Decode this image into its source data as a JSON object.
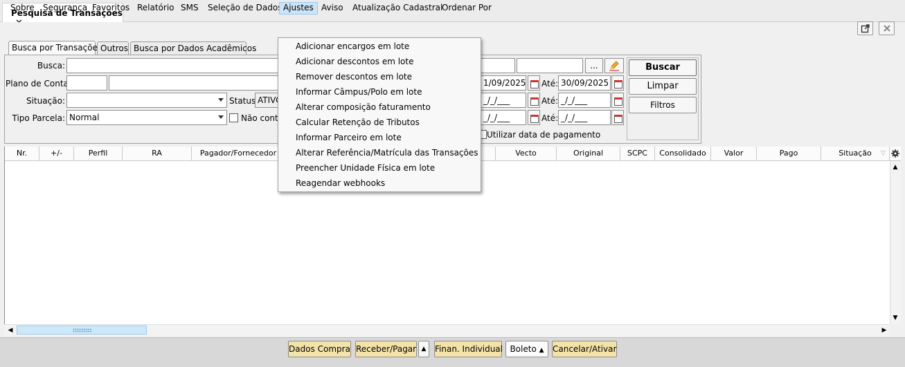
{
  "window": {
    "tab_title": "Pesquisa de Transações",
    "close_glyph": "✕",
    "popout_icon": "external-window-icon",
    "close_icon": "close-icon"
  },
  "menubar": {
    "items": [
      {
        "label": "Sobre"
      },
      {
        "label": "Segurança"
      },
      {
        "label": "Favoritos"
      },
      {
        "label": "Relatório"
      },
      {
        "label": "SMS"
      },
      {
        "label": "Seleção de Dados"
      },
      {
        "label": "Ajustes"
      },
      {
        "label": "Aviso"
      },
      {
        "label": "Atualização Cadastral"
      },
      {
        "label": "Ordenar Por"
      }
    ],
    "active": "Ajustes"
  },
  "ajustes_menu": {
    "items": [
      "Adicionar encargos em lote",
      "Adicionar descontos em lote",
      "Remover descontos em lote",
      "Informar Câmpus/Polo em lote",
      "Alterar composição faturamento",
      "Calcular Retenção de Tributos",
      "Informar Parceiro em lote",
      "Alterar Referência/Matrícula das Transações",
      "Preencher Unidade Física em lote",
      "Reagendar webhooks"
    ]
  },
  "search_tabs": [
    {
      "label": "Busca por Transações",
      "selected": true
    },
    {
      "label": "Outros",
      "selected": false
    },
    {
      "label": "Busca por Dados Acadêmicos",
      "selected": false
    }
  ],
  "form": {
    "busca_label": "Busca:",
    "busca_value": "",
    "plano_label": "Plano de Conta:",
    "situacao_label": "Situação:",
    "situacao_value": "",
    "status_label": "Status:",
    "status_value": "ATIVO",
    "tipo_parcela_label": "Tipo Parcela:",
    "tipo_parcela_value": "Normal",
    "nao_contem_label": "Não contê",
    "more_button": "...",
    "edit_icon": "pencil-icon",
    "date_rows": [
      {
        "from": "1/09/2025",
        "ate_label": "Até:",
        "to": "30/09/2025"
      },
      {
        "from": "_/_/___",
        "ate_label": "Até:",
        "to": "_/_/___"
      },
      {
        "from": "_/_/___",
        "ate_label": "Até:",
        "to": "_/_/___"
      }
    ],
    "utilizar_data_label": "Utilizar data de pagamento"
  },
  "actions": {
    "buscar": "Buscar",
    "limpar": "Limpar",
    "filtros": "Filtros"
  },
  "table": {
    "columns": [
      "Nr.",
      "+/-",
      "Perfil",
      "RA",
      "Pagador/Fornecedor",
      "Vecto",
      "Original",
      "SCPC",
      "Consolidado",
      "Valor",
      "Pago",
      "Situação"
    ],
    "rows": [],
    "settings_icon": "gear-icon"
  },
  "bottom_buttons": {
    "dados_compra": "Dados Compra",
    "receber_pagar": "Receber/Pagar",
    "finan_individual": "Finan. Individual",
    "boleto": "Boleto",
    "cancelar_ativar": "Cancelar/Ativar"
  }
}
